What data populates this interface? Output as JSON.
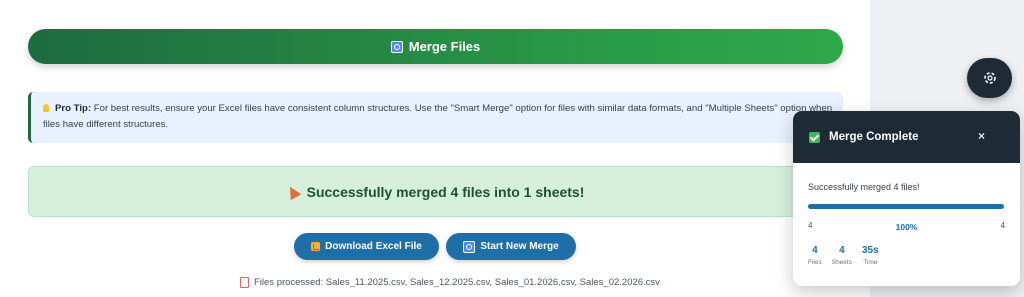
{
  "main": {
    "merge_button_label": "Merge Files",
    "tip": {
      "title": "Pro Tip:",
      "text": "For best results, ensure your Excel files have consistent column structures. Use the \"Smart Merge\" option for files with similar data formats, and \"Multiple Sheets\" option when files have different structures."
    },
    "success_message": "Successfully merged 4 files into 1 sheets!",
    "download_button_label": "Download Excel File",
    "new_merge_button_label": "Start New Merge",
    "files_processed_text": "Files processed: Sales_11.2025.csv, Sales_12.2025.csv, Sales_01.2026.csv, Sales_02.2026.csv"
  },
  "panel": {
    "title": "Merge Complete",
    "close_label": "×",
    "message": "Successfully merged 4 files!",
    "progress": {
      "current": "4",
      "total": "4",
      "percent_label": "100%",
      "fraction": 1.0
    },
    "stats": [
      {
        "value": "4",
        "label": "Files"
      },
      {
        "value": "4",
        "label": "Sheets"
      },
      {
        "value": "35s",
        "label": "Time"
      }
    ]
  },
  "colors": {
    "accent_blue": "#1e6fa8",
    "success_green": "#2a9a48",
    "panel_dark": "#1f2a37"
  }
}
